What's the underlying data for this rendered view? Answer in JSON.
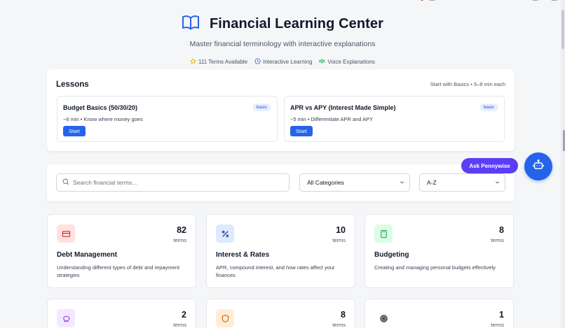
{
  "header": {
    "title": "Financial Learning Center",
    "subtitle": "Master financial terminology with interactive explanations",
    "features": [
      {
        "icon": "star-icon",
        "label": "111 Terms Available",
        "color": "#eab308"
      },
      {
        "icon": "clock-icon",
        "label": "Interactive Learning",
        "color": "#2563eb"
      },
      {
        "icon": "speaker-icon",
        "label": "Voice Explanations",
        "color": "#16a34a"
      }
    ]
  },
  "lessons": {
    "title": "Lessons",
    "note": "Start with Basics • 5–8 min each",
    "items": [
      {
        "name": "Budget Basics (50/30/20)",
        "tag": "basic",
        "meta": "~6 min • Know where money goes",
        "start_label": "Start"
      },
      {
        "name": "APR vs APY (Interest Made Simple)",
        "tag": "basic",
        "meta": "~5 min • Differentiate APR and APY",
        "start_label": "Start"
      }
    ]
  },
  "search": {
    "placeholder": "Search financial terms...",
    "value": "",
    "category_selected": "All Categories",
    "sort_selected": "A-Z"
  },
  "assistant": {
    "ask_label": "Ask Pennywise",
    "accent": "#5b3df5",
    "bot_color": "#2563eb"
  },
  "categories": [
    {
      "icon": "credit-card-icon",
      "count": "82",
      "terms_label": "terms",
      "name": "Debt Management",
      "desc": "Understanding different types of debt and repayment strategies",
      "icon_bg": "#fde2e2",
      "icon_color": "#dc2626"
    },
    {
      "icon": "percent-icon",
      "count": "10",
      "terms_label": "terms",
      "name": "Interest & Rates",
      "desc": "APR, compound interest, and how rates affect your finances",
      "icon_bg": "#dbeafe",
      "icon_color": "#1e3a8a"
    },
    {
      "icon": "calculator-icon",
      "count": "8",
      "terms_label": "terms",
      "name": "Budgeting",
      "desc": "Creating and managing personal budgets effectively",
      "icon_bg": "#dcfce7",
      "icon_color": "#16a34a"
    },
    {
      "icon": "piggy-bank-icon",
      "count": "2",
      "terms_label": "terms",
      "name": "",
      "desc": "",
      "icon_bg": "#f3e8ff",
      "icon_color": "#9333ea"
    },
    {
      "icon": "shield-icon",
      "count": "8",
      "terms_label": "terms",
      "name": "",
      "desc": "",
      "icon_bg": "#ffedd5",
      "icon_color": "#ea580c"
    },
    {
      "icon": "target-icon",
      "count": "1",
      "terms_label": "terms",
      "name": "",
      "desc": "",
      "icon_bg": "#ffffff",
      "icon_color": "#111827"
    }
  ]
}
